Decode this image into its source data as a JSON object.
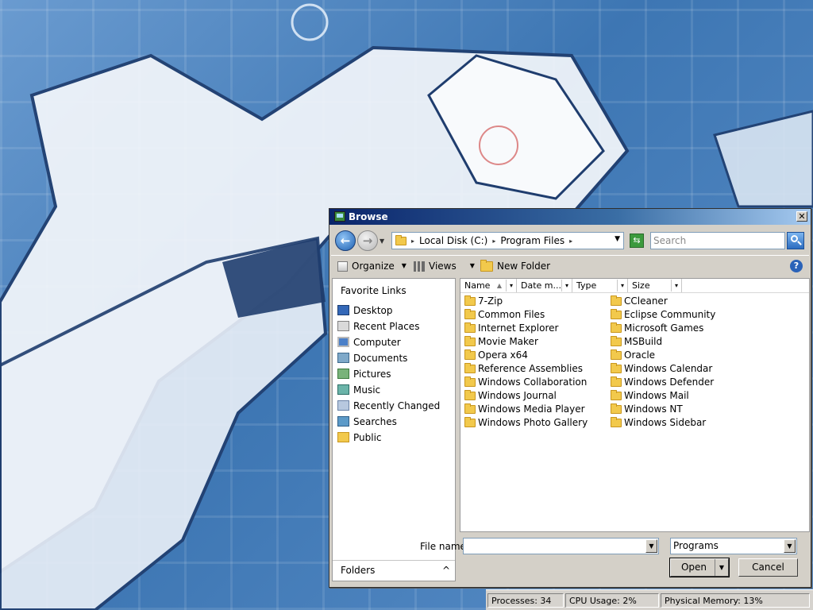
{
  "dialog": {
    "title": "Browse",
    "address": {
      "crumbs": [
        "Local Disk (C:)",
        "Program Files"
      ]
    },
    "search_placeholder": "Search",
    "toolbar": {
      "organize": "Organize",
      "views": "Views",
      "new_folder": "New Folder"
    },
    "nav": {
      "favorite_links_title": "Favorite Links",
      "items": [
        {
          "label": "Desktop",
          "icon": "desktop-icon"
        },
        {
          "label": "Recent Places",
          "icon": "recent-places-icon"
        },
        {
          "label": "Computer",
          "icon": "computer-icon"
        },
        {
          "label": "Documents",
          "icon": "documents-icon"
        },
        {
          "label": "Pictures",
          "icon": "pictures-icon"
        },
        {
          "label": "Music",
          "icon": "music-icon"
        },
        {
          "label": "Recently Changed",
          "icon": "recently-changed-icon"
        },
        {
          "label": "Searches",
          "icon": "searches-icon"
        },
        {
          "label": "Public",
          "icon": "folder-icon"
        }
      ],
      "folders_label": "Folders"
    },
    "columns": [
      "Name",
      "Date m...",
      "Type",
      "Size"
    ],
    "files_col1": [
      "7-Zip",
      "Common Files",
      "Internet Explorer",
      "Movie Maker",
      "Opera x64",
      "Reference Assemblies",
      "Windows Collaboration",
      "Windows Journal",
      "Windows Media Player",
      "Windows Photo Gallery"
    ],
    "files_col2": [
      "CCleaner",
      "Eclipse Community",
      "Microsoft Games",
      "MSBuild",
      "Oracle",
      "Windows Calendar",
      "Windows Defender",
      "Windows Mail",
      "Windows NT",
      "Windows Sidebar"
    ],
    "file_name_label": "File name:",
    "file_name_value": "",
    "filter_value": "Programs",
    "open_label": "Open",
    "cancel_label": "Cancel",
    "close_glyph": "✕"
  },
  "statusbar": {
    "processes": "Processes: 34",
    "cpu": "CPU Usage: 2%",
    "memory": "Physical Memory: 13%"
  },
  "colors": {
    "titlebar": "#0a246a",
    "folder": "#f2c94c",
    "wallpaper": "#3f73ad"
  }
}
